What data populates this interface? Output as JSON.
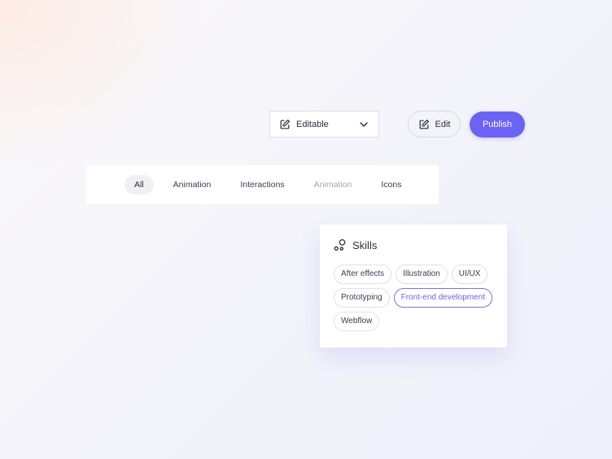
{
  "toolbar": {
    "mode_select": {
      "value": "Editable",
      "icon": "edit-icon"
    },
    "edit_label": "Edit",
    "publish_label": "Publish"
  },
  "tabs": [
    {
      "label": "All",
      "state": "active"
    },
    {
      "label": "Animation",
      "state": "normal"
    },
    {
      "label": "Interactions",
      "state": "normal"
    },
    {
      "label": "Animation",
      "state": "disabled"
    },
    {
      "label": "Icons",
      "state": "normal"
    }
  ],
  "skills": {
    "title": "Skills",
    "icon": "skills-icon",
    "chips": [
      {
        "label": "After effects",
        "selected": false
      },
      {
        "label": "Illustration",
        "selected": false
      },
      {
        "label": "UI/UX",
        "selected": false
      },
      {
        "label": "Prototyping",
        "selected": false
      },
      {
        "label": "Front-end development",
        "selected": true
      },
      {
        "label": "Webflow",
        "selected": false
      }
    ]
  },
  "colors": {
    "accent": "#6b63f5",
    "text": "#2b2d42",
    "muted": "#a4a5b5",
    "border": "#dcdce6"
  }
}
